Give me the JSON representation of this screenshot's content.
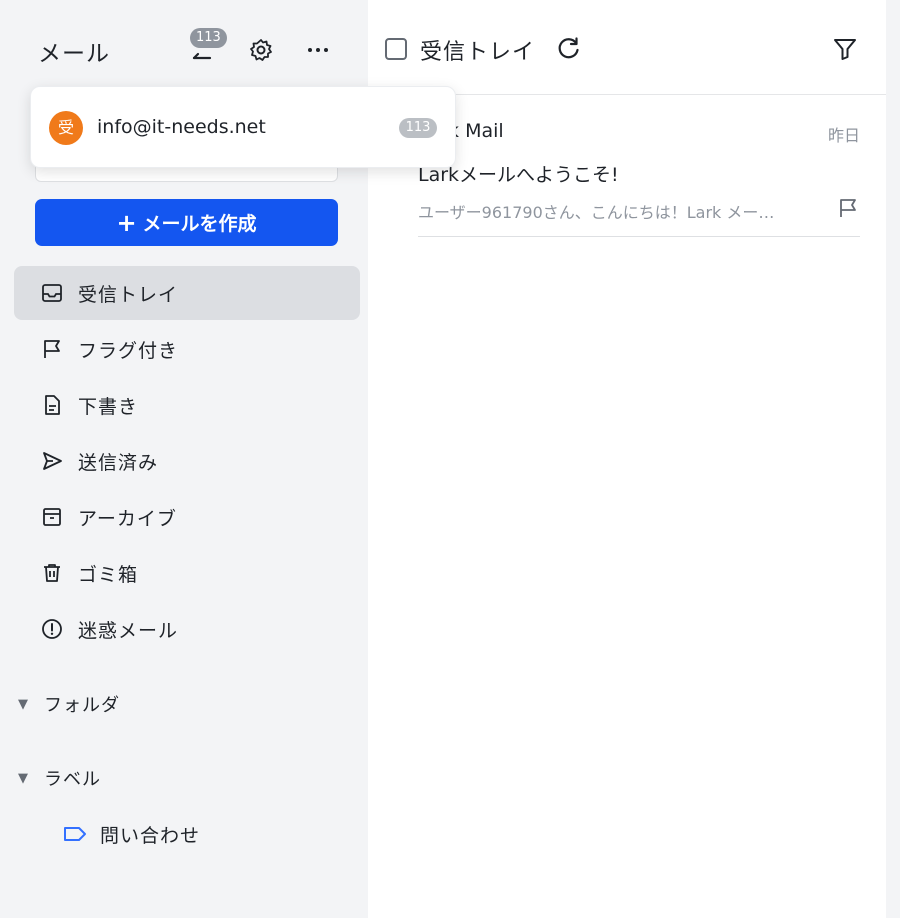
{
  "sidebar": {
    "title": "メール",
    "unread_badge": "113",
    "compose_label": "メールを作成",
    "compose_icon": "plus-icon",
    "nav": [
      {
        "label": "受信トレイ",
        "icon": "inbox-icon",
        "active": true
      },
      {
        "label": "フラグ付き",
        "icon": "flag-icon"
      },
      {
        "label": "下書き",
        "icon": "draft-icon"
      },
      {
        "label": "送信済み",
        "icon": "send-icon"
      },
      {
        "label": "アーカイブ",
        "icon": "archive-icon"
      },
      {
        "label": "ゴミ箱",
        "icon": "trash-icon"
      },
      {
        "label": "迷惑メール",
        "icon": "spam-icon"
      }
    ],
    "sections": [
      {
        "label": "フォルダ"
      },
      {
        "label": "ラベル"
      }
    ],
    "labels": [
      {
        "label": "問い合わせ",
        "color": "#3370ff"
      }
    ]
  },
  "account_popup": {
    "avatar_text": "受",
    "avatar_color": "#f07a1a",
    "email": "info@it-needs.net",
    "badge": "113"
  },
  "list": {
    "folder_title": "受信トレイ",
    "mails": [
      {
        "sender": "Lark Mail",
        "date": "昨日",
        "subject": "Larkメールへようこそ!",
        "preview": "ユーザー961790さん、こんにちは！Lark メー…"
      }
    ]
  },
  "colors": {
    "accent": "#1456f0",
    "sidebar_bg": "#f3f4f6",
    "active_bg": "#dcdee2"
  }
}
